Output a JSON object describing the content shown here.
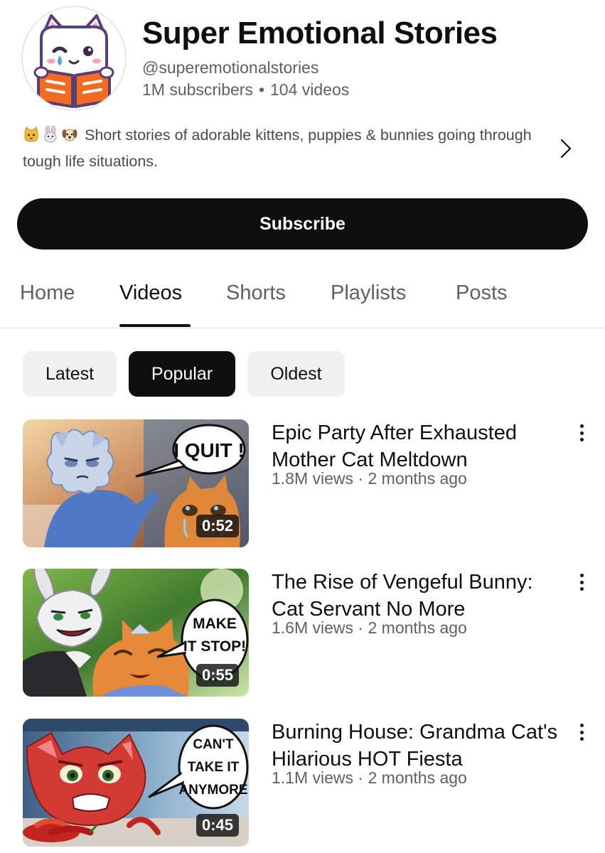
{
  "channel": {
    "name": "Super Emotional Stories",
    "handle": "@superemotionalstories",
    "subscribers": "1M subscribers",
    "separator": "•",
    "video_count": "104 videos",
    "description_emojis": [
      "cat-face-icon",
      "rabbit-face-icon",
      "dog-face-icon"
    ],
    "description": "Short stories of adorable kittens, puppies & bunnies going through tough life situations.",
    "avatar_icon": "crying-cat-reading-book-logo"
  },
  "subscribe_label": "Subscribe",
  "tabs": [
    {
      "label": "Home",
      "active": false
    },
    {
      "label": "Videos",
      "active": true
    },
    {
      "label": "Shorts",
      "active": false
    },
    {
      "label": "Playlists",
      "active": false
    },
    {
      "label": "Posts",
      "active": false
    }
  ],
  "sort_chips": [
    {
      "label": "Latest",
      "active": false
    },
    {
      "label": "Popular",
      "active": true
    },
    {
      "label": "Oldest",
      "active": false
    }
  ],
  "videos": [
    {
      "title": "Epic Party After Exhausted Mother Cat Meltdown",
      "meta": "1.8M views · 2 months ago",
      "duration": "0:52",
      "bubble": [
        "I QUIT !"
      ]
    },
    {
      "title": "The Rise of Vengeful Bunny: Cat Servant No More",
      "meta": "1.6M views · 2 months ago",
      "duration": "0:55",
      "bubble": [
        "MAKE",
        "IT STOP!"
      ]
    },
    {
      "title": "Burning House: Grandma Cat's Hilarious HOT Fiesta",
      "meta": "1.1M views · 2 months ago",
      "duration": "0:45",
      "bubble": [
        "CAN'T",
        "TAKE IT",
        "ANYMORE"
      ]
    }
  ],
  "colors": {
    "primary_text": "#0f0f0f",
    "secondary_text": "#606060",
    "chip_bg": "#f0f0f0",
    "logo_orange": "#f26b21",
    "logo_purple": "#5a3e7a"
  }
}
